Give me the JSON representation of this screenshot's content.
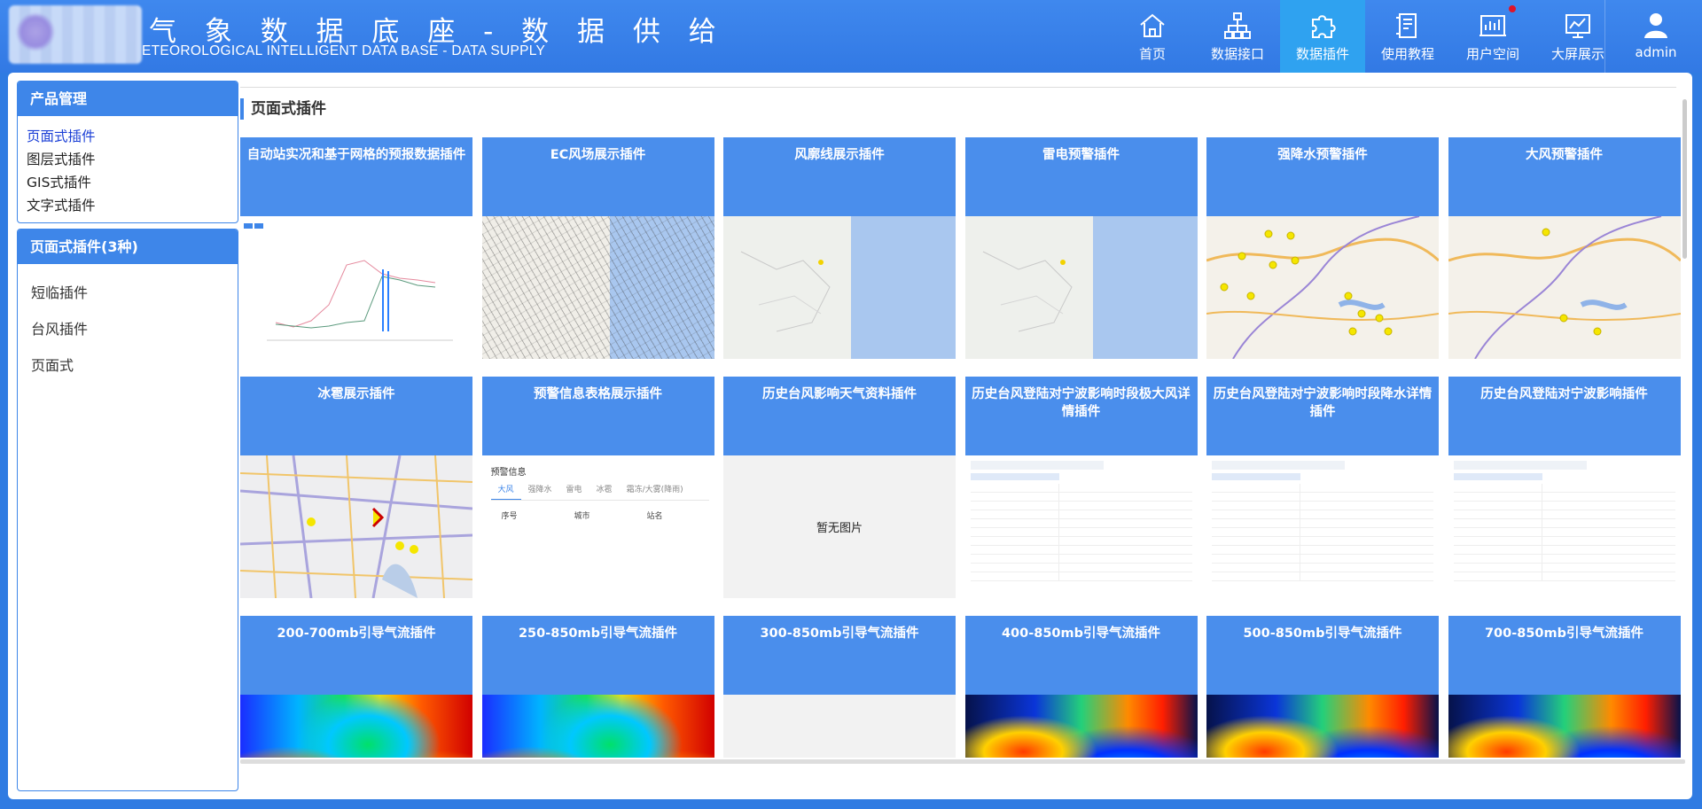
{
  "header": {
    "title_zh": "气 象 数 据 底 座 - 数 据 供 给",
    "title_en": "ETEOROLOGICAL INTELLIGENT DATA BASE - DATA SUPPLY",
    "nav": [
      {
        "label": "首页",
        "icon": "home-icon"
      },
      {
        "label": "数据接口",
        "icon": "hierarchy-icon"
      },
      {
        "label": "数据插件",
        "icon": "puzzle-icon"
      },
      {
        "label": "使用教程",
        "icon": "tutorial-icon"
      },
      {
        "label": "用户空间",
        "icon": "user-space-icon"
      },
      {
        "label": "大屏展示",
        "icon": "big-screen-icon"
      }
    ],
    "active_nav": "数据插件",
    "user": "admin"
  },
  "sidebar": {
    "product_title": "产品管理",
    "product_items": [
      "页面式插件",
      "图层式插件",
      "GIS式插件",
      "文字式插件"
    ],
    "active_product": "页面式插件",
    "category_title": "页面式插件(3种)",
    "category_items": [
      "短临插件",
      "台风插件",
      "页面式"
    ]
  },
  "content": {
    "section_title": "页面式插件",
    "no_image": "暂无图片",
    "cards": [
      {
        "title": "自动站实况和基于网格的预报数据插件",
        "thumb": "chart"
      },
      {
        "title": "EC风场展示插件",
        "thumb": "wind"
      },
      {
        "title": "风廓线展示插件",
        "thumb": "map"
      },
      {
        "title": "雷电预警插件",
        "thumb": "map"
      },
      {
        "title": "强降水预警插件",
        "thumb": "road"
      },
      {
        "title": "大风预警插件",
        "thumb": "road"
      },
      {
        "title": "冰雹展示插件",
        "thumb": "city"
      },
      {
        "title": "预警信息表格展示插件",
        "thumb": "table"
      },
      {
        "title": "历史台风影响天气资料插件",
        "thumb": "none"
      },
      {
        "title": "历史台风登陆对宁波影响时段极大风详情插件",
        "thumb": "doc"
      },
      {
        "title": "历史台风登陆对宁波影响时段降水详情插件",
        "thumb": "doc"
      },
      {
        "title": "历史台风登陆对宁波影响插件",
        "thumb": "doc"
      },
      {
        "title": "200-700mb引导气流插件",
        "thumb": "heat"
      },
      {
        "title": "250-850mb引导气流插件",
        "thumb": "heat"
      },
      {
        "title": "300-850mb引导气流插件",
        "thumb": "none"
      },
      {
        "title": "400-850mb引导气流插件",
        "thumb": "heat-dark"
      },
      {
        "title": "500-850mb引导气流插件",
        "thumb": "heat-dark"
      },
      {
        "title": "700-850mb引导气流插件",
        "thumb": "heat-dark"
      }
    ],
    "table_thumb": {
      "title": "预警信息",
      "tabs": [
        "大风",
        "强降水",
        "雷电",
        "冰雹",
        "霜冻/大雾(降雨)"
      ],
      "columns": [
        "序号",
        "城市",
        "站名"
      ]
    }
  },
  "colors": {
    "header_bg": "#3279e4",
    "active_nav_bg": "#2fa2f0",
    "card_header_bg": "#4a8eec",
    "sidebar_accent": "#3e86e9",
    "active_link": "#1b3fd6",
    "notification_dot": "#e0142a"
  }
}
